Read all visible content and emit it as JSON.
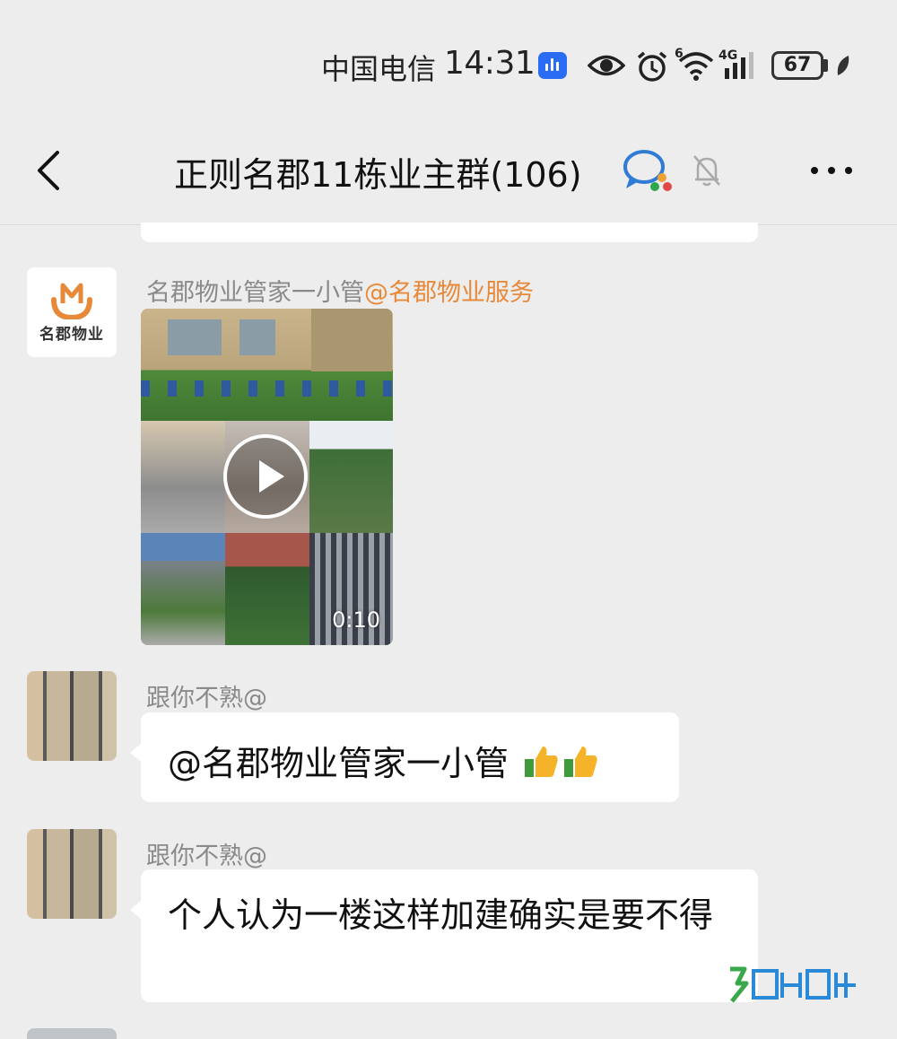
{
  "status_bar": {
    "carrier": "中国电信",
    "time": "14:31",
    "battery": "67",
    "network": "4G",
    "wifi_badge": "6"
  },
  "nav": {
    "title": "正则名郡11栋业主群(106)"
  },
  "messages": [
    {
      "sender": "名郡物业管家一小管",
      "mention": "@名郡物业服务",
      "avatar_text": "名郡物业",
      "type": "video",
      "duration": "0:10"
    },
    {
      "sender": "跟你不熟@",
      "type": "text",
      "text": "@名郡物业管家一小管 "
    },
    {
      "sender": "跟你不熟@",
      "type": "text",
      "text": "个人认为一楼这样加建确实是要不得"
    }
  ],
  "colors": {
    "background": "#ededed",
    "bubble": "#ffffff",
    "mention": "#e8893a",
    "sender": "#8a8a8a",
    "logo": "#e8893a"
  },
  "icons": [
    "back-icon",
    "group-chat-icon",
    "mute-bell-icon",
    "more-icon",
    "eye-icon",
    "alarm-icon",
    "wifi-icon",
    "signal-icon",
    "battery-icon",
    "thumbs-up-icon",
    "play-icon"
  ]
}
